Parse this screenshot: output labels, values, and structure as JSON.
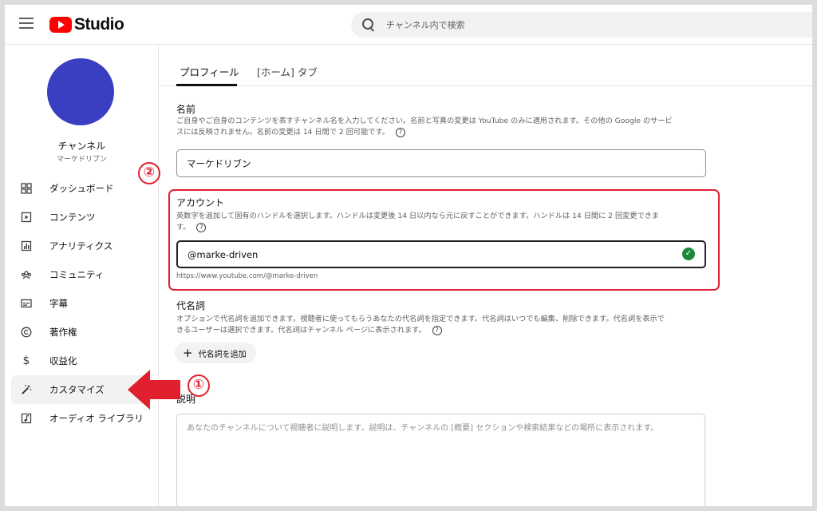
{
  "header": {
    "logo_text": "Studio",
    "search_placeholder": "チャンネル内で検索"
  },
  "channel": {
    "title": "チャンネル",
    "name": "マーケドリブン"
  },
  "sidebar": {
    "items": [
      {
        "label": "ダッシュボード",
        "icon": "dashboard-icon"
      },
      {
        "label": "コンテンツ",
        "icon": "content-icon"
      },
      {
        "label": "アナリティクス",
        "icon": "analytics-icon"
      },
      {
        "label": "コミュニティ",
        "icon": "community-icon"
      },
      {
        "label": "字幕",
        "icon": "subtitles-icon"
      },
      {
        "label": "著作権",
        "icon": "copyright-icon"
      },
      {
        "label": "収益化",
        "icon": "dollar-icon"
      },
      {
        "label": "カスタマイズ",
        "icon": "magic-wand-icon"
      },
      {
        "label": "オーディオ ライブラリ",
        "icon": "audio-library-icon"
      }
    ]
  },
  "tabs": [
    "プロフィール",
    "[ホーム] タブ"
  ],
  "profile": {
    "name_label": "名前",
    "name_desc_1": "ご自身やご自身のコンテンツを表すチャンネル名を入力してください。名前と写真の変更は YouTube のみに適用されます。その他の Google のサービ",
    "name_desc_2": "スには反映されません。名前の変更は 14 日間で 2 回可能です。",
    "name_value": "マーケドリブン",
    "account_label": "アカウント",
    "account_desc_1": "英数字を追加して固有のハンドルを選択します。ハンドルは変更後 14 日以内なら元に戻すことができます。ハンドルは 14 日間に 2 回変更できま",
    "account_desc_2": "す。",
    "handle_value": "@marke-driven",
    "handle_url": "https://www.youtube.com/@marke-driven",
    "pronoun_label": "代名詞",
    "pronoun_desc_1": "オプションで代名詞を追加できます。視聴者に使ってもらうあなたの代名詞を指定できます。代名詞はいつでも編集、削除できます。代名詞を表示で",
    "pronoun_desc_2": "きるユーザーは選択できます。代名詞はチャンネル ページに表示されます。",
    "add_pronoun_label": "代名詞を追加",
    "description_label": "説明",
    "description_placeholder": "あなたのチャンネルについて視聴者に説明します。説明は、チャンネルの [概要] セクションや検索結果などの場所に表示されます。"
  },
  "annotations": {
    "step1": "①",
    "step2": "②",
    "color": "#e0202e"
  }
}
